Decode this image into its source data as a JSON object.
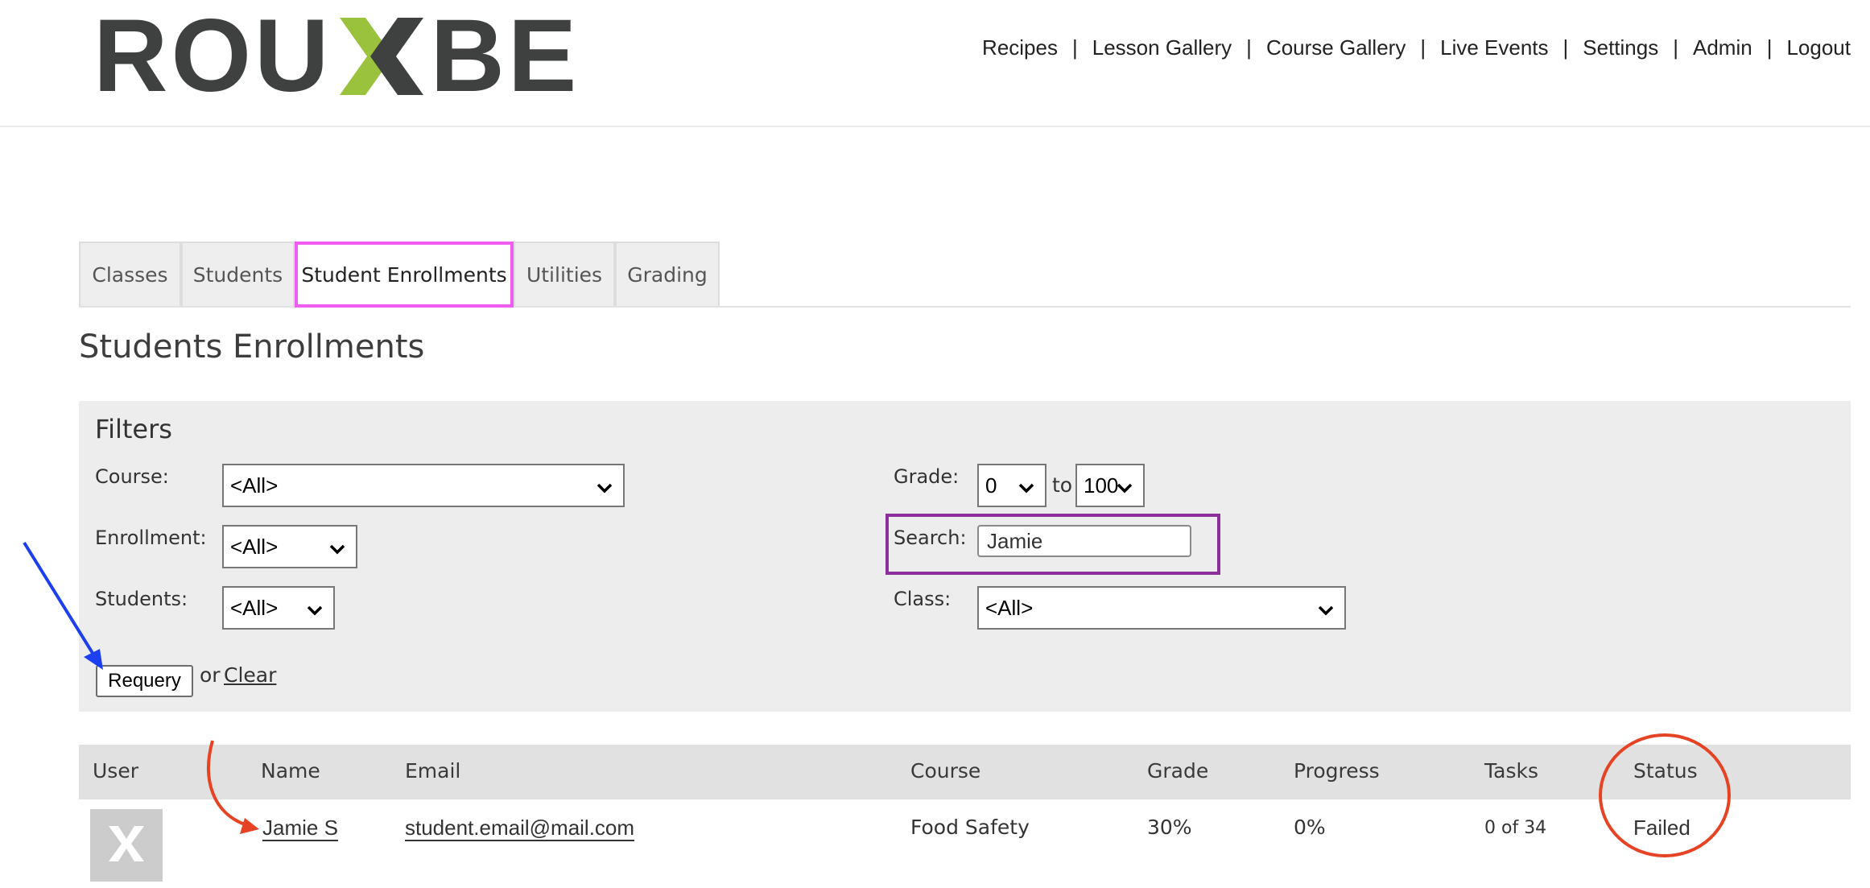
{
  "header": {
    "logo_text_left": "ROU",
    "logo_text_right": "BE",
    "nav": [
      "Recipes",
      "Lesson Gallery",
      "Course Gallery",
      "Live Events",
      "Settings",
      "Admin",
      "Logout"
    ],
    "separator": "|"
  },
  "tabs": [
    "Classes",
    "Students",
    "Student Enrollments",
    "Utilities",
    "Grading"
  ],
  "active_tab": "Student Enrollments",
  "page_title": "Students Enrollments",
  "filters": {
    "title": "Filters",
    "course_label": "Course:",
    "course_value": "<All>",
    "enrollment_label": "Enrollment:",
    "enrollment_value": "<All>",
    "students_label": "Students:",
    "students_value": "<All>",
    "grade_label": "Grade:",
    "grade_from": "0",
    "grade_to_word": "to",
    "grade_to": "100",
    "search_label": "Search:",
    "search_value": "Jamie",
    "class_label": "Class:",
    "class_value": "<All>",
    "requery_label": "Requery",
    "or_text": "or",
    "clear_label": "Clear"
  },
  "table": {
    "columns": [
      "User",
      "Name",
      "Email",
      "Course",
      "Grade",
      "Progress",
      "Tasks",
      "Status"
    ],
    "rows": [
      {
        "name": "Jamie S",
        "email": "student.email@mail.com",
        "course": "Food Safety",
        "grade": "30%",
        "progress": "0%",
        "tasks": "0 of 34",
        "status": "Failed"
      }
    ]
  },
  "colors": {
    "logo_dark": "#3f4040",
    "logo_green": "#9ac23c",
    "active_tab_highlight": "#ef5cf0",
    "search_highlight": "#8b2f9b",
    "arrow_blue": "#1c3ff0",
    "arrow_red": "#e64324"
  },
  "icons": [
    "rouxbe-x-logo-icon",
    "chevron-down-icon",
    "avatar-placeholder-icon"
  ]
}
